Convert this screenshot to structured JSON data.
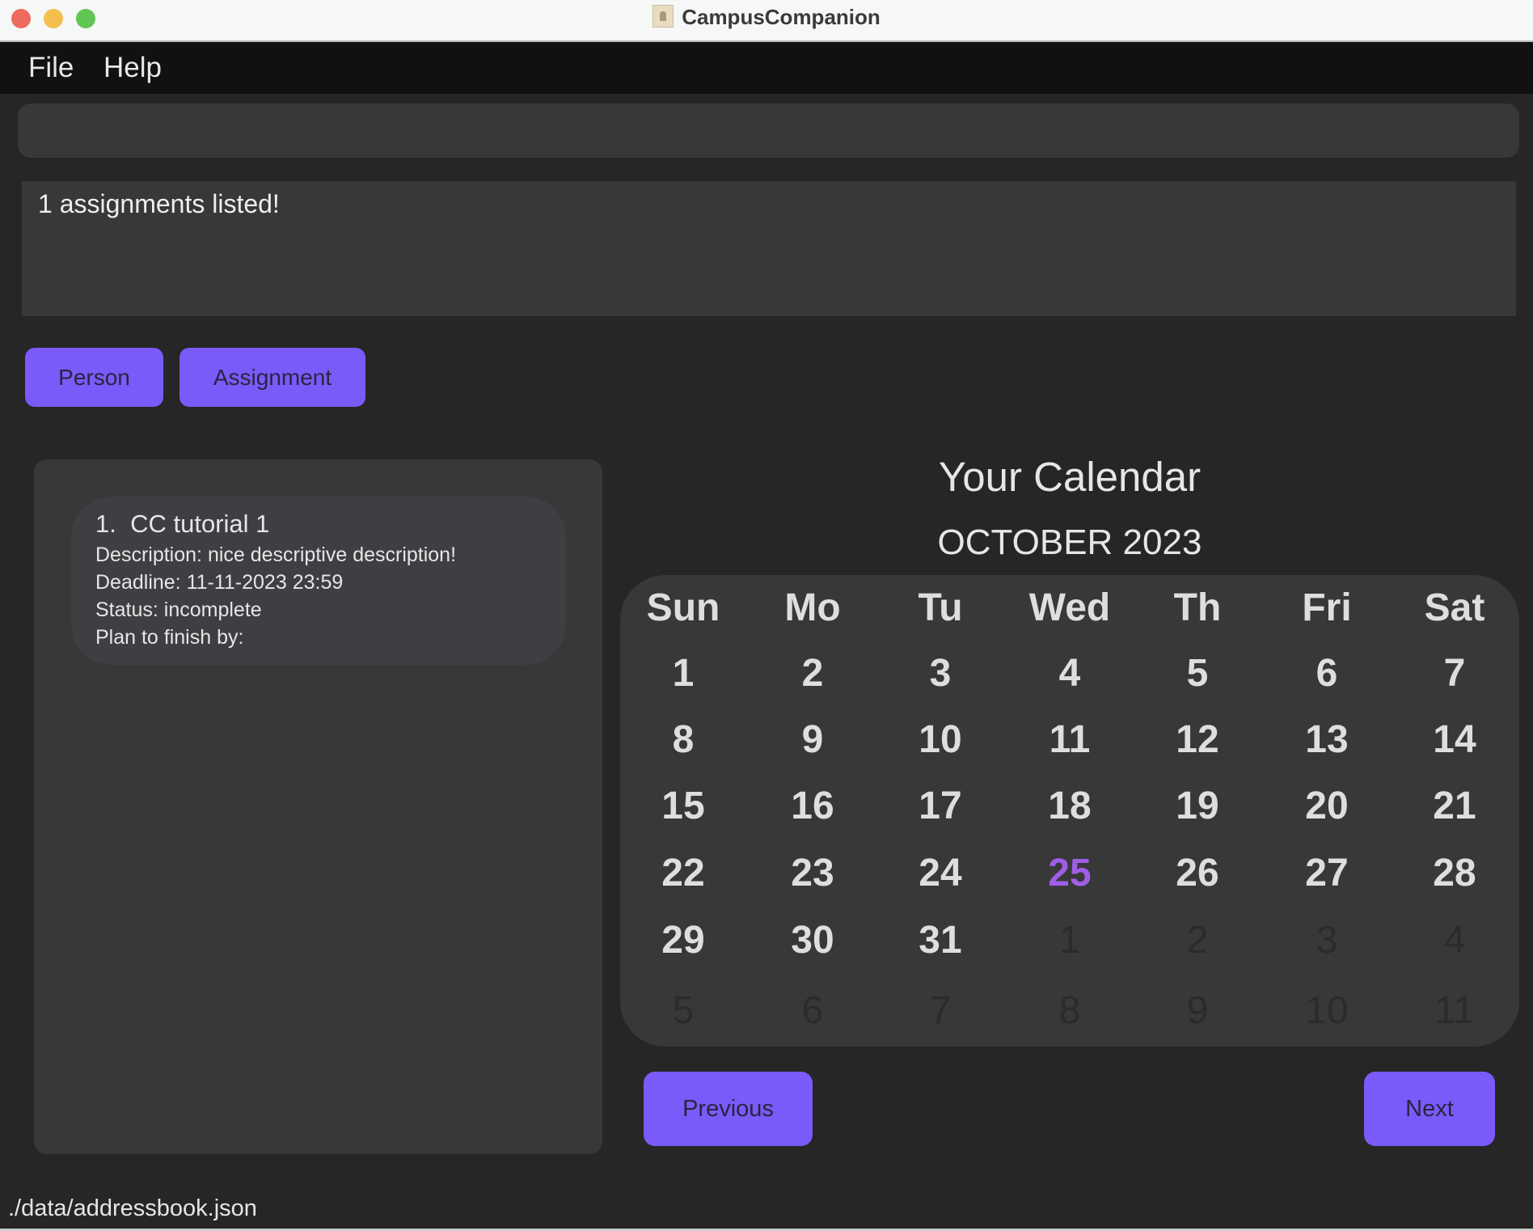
{
  "window": {
    "title": "CampusCompanion",
    "icon": "app-icon"
  },
  "menu": {
    "items": [
      "File",
      "Help"
    ]
  },
  "command_box": {
    "value": "",
    "placeholder": ""
  },
  "result_display": {
    "text": "1 assignments listed!"
  },
  "tabs": {
    "person": "Person",
    "assignment": "Assignment"
  },
  "assignments": [
    {
      "index": "1.",
      "title": "CC tutorial 1",
      "description": "Description: nice descriptive description!",
      "deadline": "Deadline: 11-11-2023 23:59",
      "status": "Status: incomplete",
      "plan": "Plan to finish by:"
    }
  ],
  "calendar": {
    "title": "Your Calendar",
    "month": "OCTOBER 2023",
    "weekdays": [
      "Sun",
      "Mo",
      "Tu",
      "Wed",
      "Th",
      "Fri",
      "Sat"
    ],
    "days": [
      [
        "1",
        "2",
        "3",
        "4",
        "5",
        "6",
        "7"
      ],
      [
        "8",
        "9",
        "10",
        "11",
        "12",
        "13",
        "14"
      ],
      [
        "15",
        "16",
        "17",
        "18",
        "19",
        "20",
        "21"
      ],
      [
        "22",
        "23",
        "24",
        "25",
        "26",
        "27",
        "28"
      ],
      [
        "29",
        "30",
        "31",
        "1",
        "2",
        "3",
        "4"
      ],
      [
        "5",
        "6",
        "7",
        "8",
        "9",
        "10",
        "11"
      ]
    ],
    "first_other_month_index": 31,
    "today": "25",
    "prev_label": "Previous",
    "next_label": "Next"
  },
  "colors": {
    "accent": "#7a5af8",
    "today": "#a05ee8",
    "background": "#262626",
    "panel": "#383838"
  },
  "status_bar": {
    "path": "./data/addressbook.json"
  }
}
